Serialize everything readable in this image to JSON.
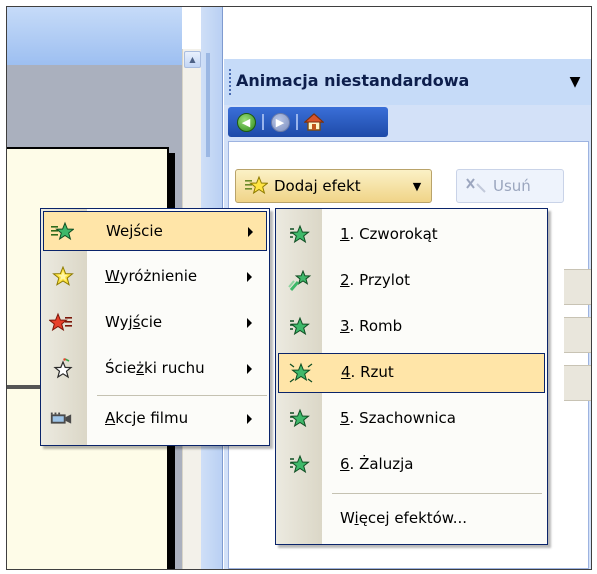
{
  "task_pane": {
    "title": "Animacja niestandardowa",
    "add_effect_label": "Dodaj efekt",
    "remove_label": "Usuń"
  },
  "effect_menu": {
    "items": [
      {
        "pre": "We",
        "ul": "j",
        "post": "ście",
        "has_submenu": true,
        "highlighted": true,
        "icon": "green-star-entrance-icon"
      },
      {
        "pre": "",
        "ul": "W",
        "post": "yróżnienie",
        "has_submenu": true,
        "highlighted": false,
        "icon": "yellow-star-emphasis-icon"
      },
      {
        "pre": "Wyj",
        "ul": "ś",
        "post": "cie",
        "has_submenu": true,
        "highlighted": false,
        "icon": "red-star-exit-icon"
      },
      {
        "pre": "Ście",
        "ul": "ż",
        "post": "ki ruchu",
        "has_submenu": true,
        "highlighted": false,
        "icon": "motion-path-star-icon"
      },
      {
        "pre": "",
        "ul": "A",
        "post": "kcje filmu",
        "has_submenu": true,
        "highlighted": false,
        "icon": "film-action-icon"
      }
    ]
  },
  "entrance_submenu": {
    "items": [
      {
        "ul": "1",
        "post": ". Czworokąt",
        "highlighted": false,
        "icon": "box-effect-star-icon"
      },
      {
        "ul": "2",
        "post": ". Przylot",
        "highlighted": false,
        "icon": "fly-in-star-icon"
      },
      {
        "ul": "3",
        "post": ". Romb",
        "highlighted": false,
        "icon": "diamond-effect-star-icon"
      },
      {
        "ul": "4",
        "post": ". Rzut",
        "highlighted": true,
        "icon": "zoom-effect-star-icon"
      },
      {
        "ul": "5",
        "post": ". Szachownica",
        "highlighted": false,
        "icon": "checkerboard-star-icon"
      },
      {
        "ul": "6",
        "post": ". Żaluzja",
        "highlighted": false,
        "icon": "blinds-star-icon"
      }
    ],
    "more": {
      "pre": "W",
      "ul": "i",
      "post": "ęcej efektów..."
    }
  },
  "colors": {
    "highlight": "#ffe5a8",
    "menu_border": "#0a246a",
    "pane_header": "#c6dbf8",
    "nav_bar": "#2c5ec4",
    "slide": "#fefce8"
  }
}
